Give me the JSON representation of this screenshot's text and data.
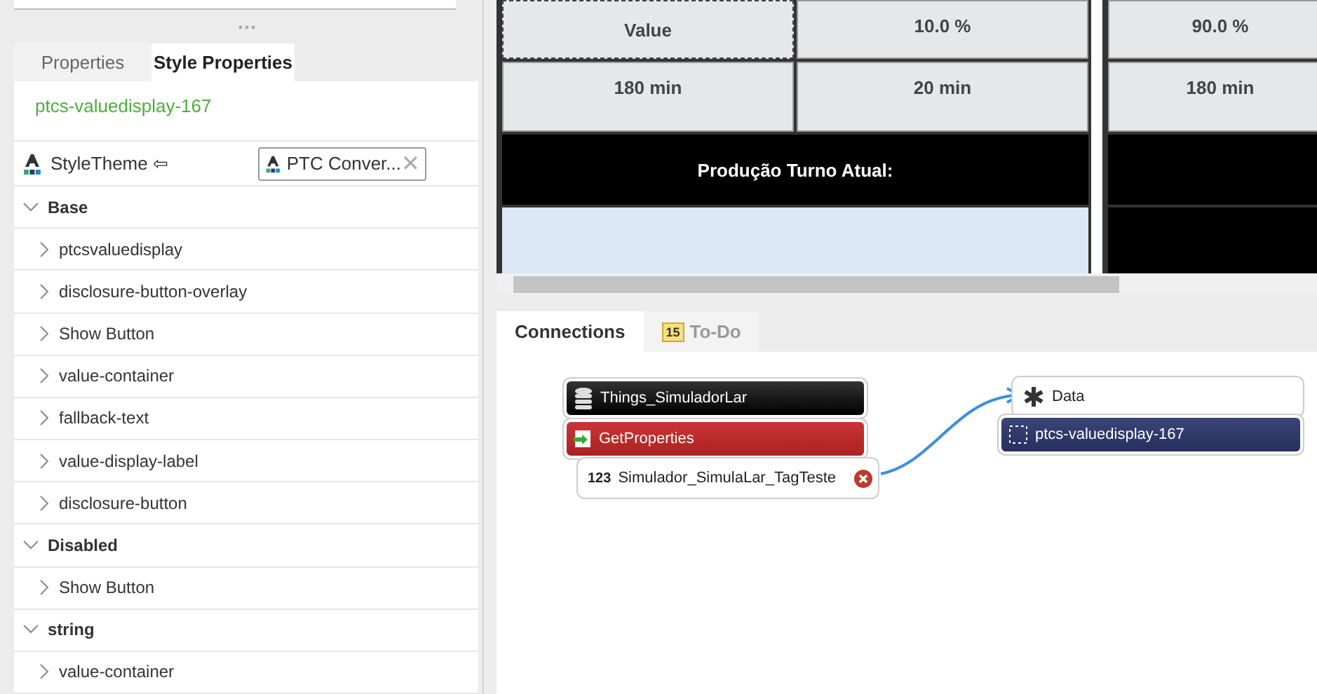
{
  "panel_tabs": [
    {
      "label": "Properties",
      "selected": false
    },
    {
      "label": "Style Properties",
      "selected": true
    }
  ],
  "widget_id": "ptcs-valuedisplay-167",
  "style_theme": {
    "label": "StyleTheme",
    "arrow": "⇦",
    "value": "PTC Conver...",
    "clear": "✕"
  },
  "style_tree": [
    {
      "label": "Base",
      "expanded": true,
      "children": [
        {
          "label": "ptcsvaluedisplay"
        },
        {
          "label": "disclosure-button-overlay"
        },
        {
          "label": "Show Button"
        },
        {
          "label": "value-container"
        },
        {
          "label": "fallback-text"
        },
        {
          "label": "value-display-label"
        },
        {
          "label": "disclosure-button"
        }
      ]
    },
    {
      "label": "Disabled",
      "expanded": true,
      "children": [
        {
          "label": "Show Button"
        }
      ]
    },
    {
      "label": "string",
      "expanded": true,
      "children": [
        {
          "label": "value-container"
        }
      ]
    }
  ],
  "grid_left": [
    [
      {
        "text": "Value",
        "kind": "selected"
      },
      {
        "text": "10.0 %",
        "kind": "plain"
      }
    ],
    [
      {
        "text": "180 min",
        "kind": "plain"
      },
      {
        "text": "20 min",
        "kind": "plain"
      }
    ],
    [
      {
        "text": "Produção Turno Atual:",
        "kind": "dark"
      }
    ],
    [
      {
        "kind": "blank"
      }
    ]
  ],
  "grid_right": [
    {
      "text": "90.0 %",
      "kind": "plain"
    },
    {
      "text": "180 min",
      "kind": "plain"
    },
    {
      "kind": "dark"
    },
    {
      "kind": "dark"
    }
  ],
  "bottom_tabs": [
    {
      "label": "Connections",
      "selected": true
    },
    {
      "label": "To-Do",
      "badge": "15",
      "selected": false
    }
  ],
  "connections": [
    {
      "label": "Things_SimuladorLar",
      "kind": "thing"
    },
    {
      "label": "GetProperties",
      "kind": "service"
    },
    {
      "label": "Simulador_SimulaLar_TagTeste",
      "prefix": "123",
      "kind": "param"
    },
    {
      "label": "Data",
      "kind": "data"
    },
    {
      "label": "ptcs-valuedisplay-167",
      "kind": "widget"
    }
  ]
}
